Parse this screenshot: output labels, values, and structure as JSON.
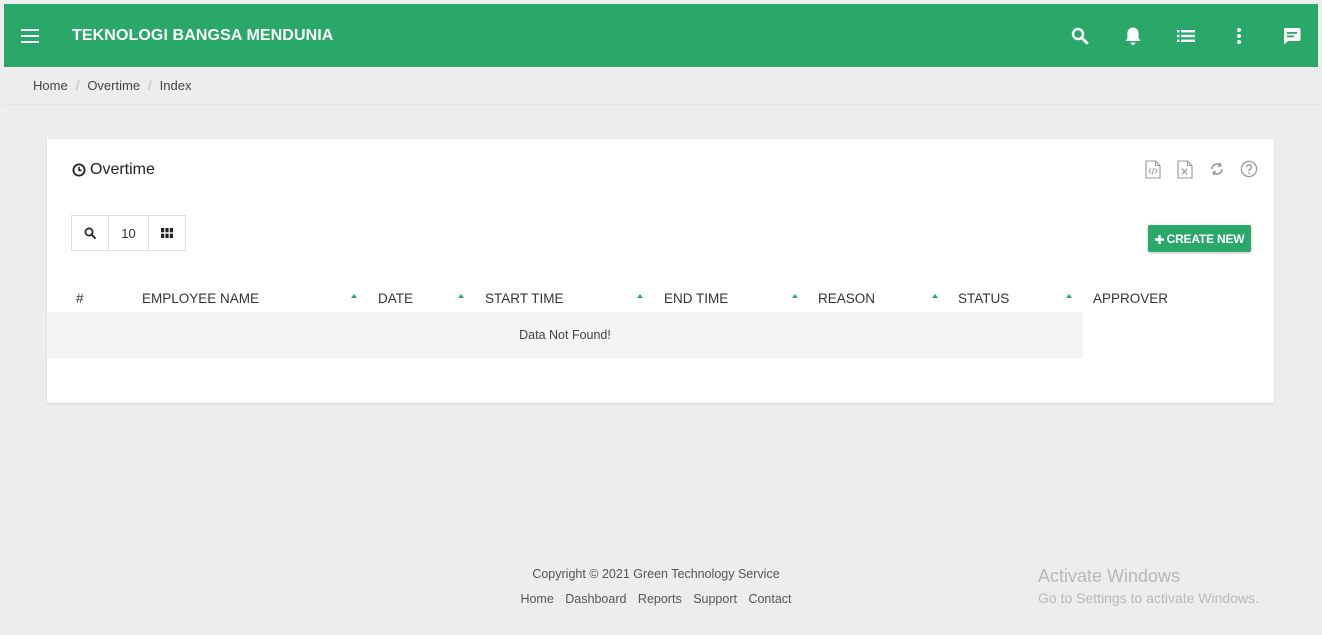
{
  "header": {
    "brand": "TEKNOLOGI BANGSA MENDUNIA",
    "icons": [
      "menu-icon",
      "search-icon",
      "bell-icon",
      "list-icon",
      "more-vert-icon",
      "chat-icon"
    ],
    "color": "#29a86a"
  },
  "breadcrumb": [
    "Home",
    "Overtime",
    "Index"
  ],
  "breadcrumb_separator": "/",
  "card": {
    "title": "Overtime",
    "title_icon": "clock-icon",
    "tool_icons": [
      "export-html-icon",
      "export-excel-icon",
      "refresh-icon",
      "help-icon"
    ],
    "page_size": "10",
    "create_label": "CREATE NEW"
  },
  "table": {
    "columns": [
      "#",
      "EMPLOYEE NAME",
      "DATE",
      "START TIME",
      "END TIME",
      "REASON",
      "STATUS",
      "APPROVER"
    ],
    "empty_message": "Data Not Found!"
  },
  "footer": {
    "copyright": "Copyright © 2021 Green Technology Service",
    "links": [
      "Home",
      "Dashboard",
      "Reports",
      "Support",
      "Contact"
    ]
  },
  "watermark": {
    "line1": "Activate Windows",
    "line2": "Go to Settings to activate Windows."
  }
}
